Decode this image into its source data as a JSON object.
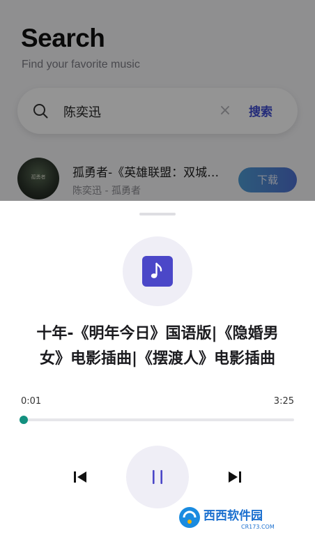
{
  "search_page": {
    "title": "Search",
    "subtitle": "Find your favorite music",
    "search": {
      "value": "陈奕迅",
      "clear_icon": "close-icon",
      "submit_label": "搜索"
    },
    "results": [
      {
        "name": "孤勇者-《英雄联盟：双城之战》动画剧集中文主题曲",
        "meta": "陈奕迅 - 孤勇者",
        "download_label": "下载",
        "cover_text": "孤勇者"
      }
    ]
  },
  "player": {
    "art_icon": "music-note-icon",
    "track_title": "十年-《明年今日》国语版|《隐婚男女》电影插曲|《摆渡人》电影插曲",
    "time_current": "0:01",
    "time_total": "3:25",
    "progress": 0.005,
    "controls": {
      "prev_icon": "skip-previous-icon",
      "pause_icon": "pause-icon",
      "next_icon": "skip-next-icon"
    }
  },
  "watermark": {
    "text": "西西软件园",
    "subtext": "CR173.COM"
  },
  "colors": {
    "accent": "#4b47c8",
    "progress": "#17a691",
    "link": "#3d4bd0"
  }
}
